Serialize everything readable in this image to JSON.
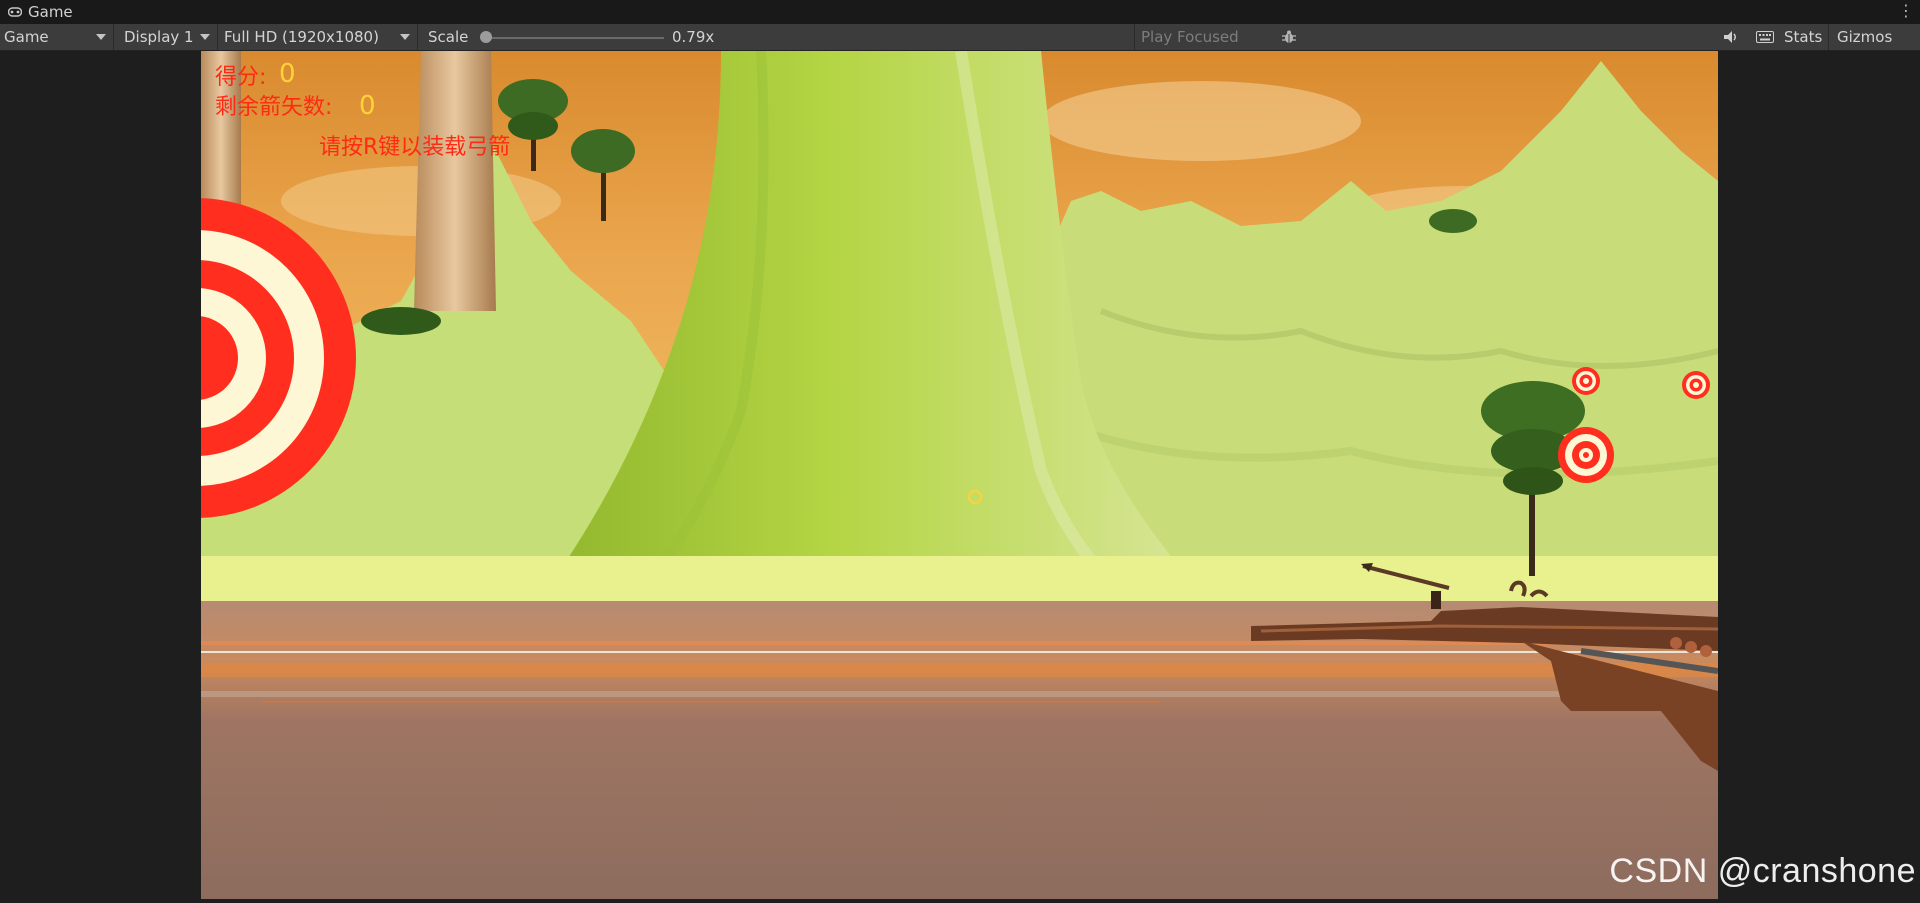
{
  "tab": {
    "title": "Game",
    "icon": "gamepad-icon"
  },
  "toolbar": {
    "view_mode": "Game",
    "display": "Display 1",
    "resolution": "Full HD (1920x1080)",
    "scale_label": "Scale",
    "scale_value": "0.79x",
    "scale_fraction": 0.02,
    "play_mode": "Play Focused",
    "stats_label": "Stats",
    "gizmos_label": "Gizmos",
    "icons": [
      "bug-icon",
      "speaker-icon",
      "keyboard-icon"
    ]
  },
  "hud": {
    "score_label": "得分:",
    "score_value": "0",
    "arrows_label": "剩余箭矢数:",
    "arrows_value": "0",
    "reload_hint": "请按R键以装载弓箭"
  },
  "colors": {
    "hud_label": "#ff2a14",
    "hud_value": "#ffd23a",
    "target_red": "#ff2e1f",
    "target_cream": "#fdf7d6",
    "sky": "#e9a045",
    "terrain": "#c9e07a"
  },
  "watermark": "CSDN @cranshone"
}
